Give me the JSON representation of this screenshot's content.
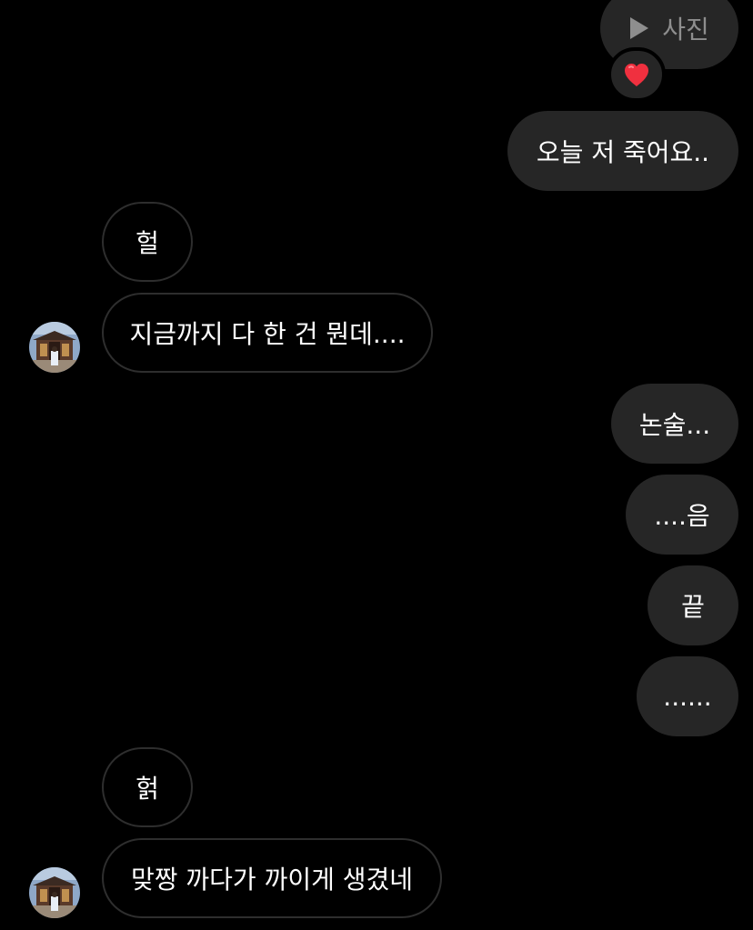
{
  "photo_message": {
    "label": "사진",
    "icon": "play-icon"
  },
  "reaction": {
    "emoji": "❤️",
    "icon": "heart-icon"
  },
  "messages": [
    {
      "side": "sent",
      "text": "오늘 저 죽어요.."
    },
    {
      "side": "received",
      "text": "헐"
    },
    {
      "side": "received",
      "text": "지금까지 다 한 건 뭔데...."
    },
    {
      "side": "sent",
      "text": "논술..."
    },
    {
      "side": "sent",
      "text": "....음"
    },
    {
      "side": "sent",
      "text": "끝"
    },
    {
      "side": "sent",
      "text": "......"
    },
    {
      "side": "received",
      "text": "헑"
    },
    {
      "side": "received",
      "text": "맞짱 까다가 까이게 생겼네"
    }
  ],
  "colors": {
    "background": "#000000",
    "sent_bubble": "#262626",
    "received_border": "#2e2e2e",
    "text": "#ffffff",
    "muted_text": "#8e8e8e"
  }
}
